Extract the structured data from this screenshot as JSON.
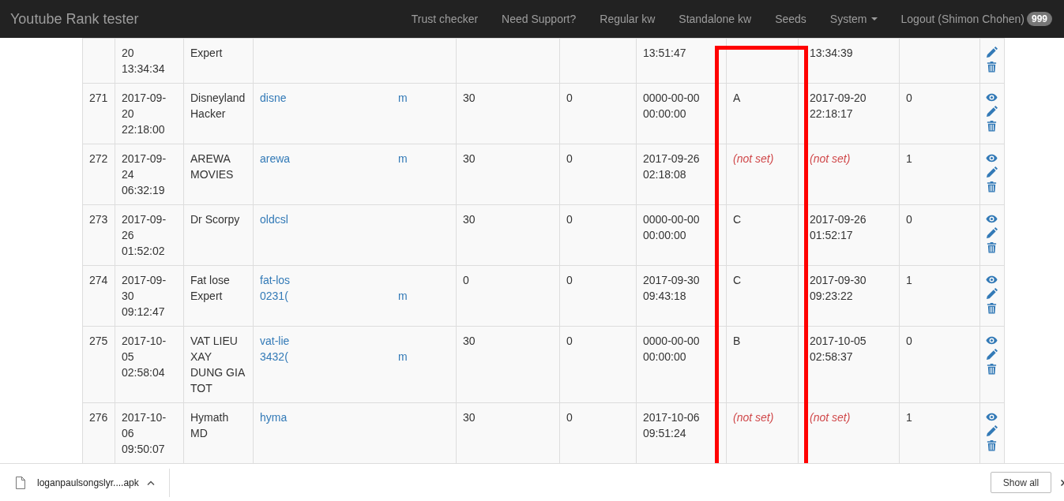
{
  "navbar": {
    "brand": "Youtube Rank tester",
    "links": [
      {
        "label": "Trust checker",
        "kind": "link"
      },
      {
        "label": "Need Support?",
        "kind": "link"
      },
      {
        "label": "Regular kw",
        "kind": "link"
      },
      {
        "label": "Standalone kw",
        "kind": "link"
      },
      {
        "label": "Seeds",
        "kind": "link"
      },
      {
        "label": "System",
        "kind": "dropdown"
      },
      {
        "label": "Logout (Shimon Chohen)",
        "kind": "link",
        "badge": "999"
      }
    ]
  },
  "table": {
    "rows": [
      {
        "created": [
          "20",
          "13:34:34"
        ],
        "name": [
          "Expert"
        ],
        "column_7": [
          "13:51:47"
        ],
        "column_9": {
          "kind": "value",
          "lines": [
            "13:34:39"
          ]
        },
        "actions": [
          {
            "kind": "edit"
          },
          {
            "kind": "delete"
          }
        ]
      },
      {
        "id": "271",
        "created": [
          "2017-09-",
          "20",
          "22:18:00"
        ],
        "name": [
          "Disneyland",
          "Hacker"
        ],
        "email": [
          {
            "text": "disne",
            "tail": "m"
          }
        ],
        "column_5": "30",
        "column_6": "0",
        "column_7": [
          "0000-00-00",
          "00:00:00"
        ],
        "column_8": {
          "kind": "value",
          "lines": [
            "A"
          ]
        },
        "column_9": {
          "kind": "value",
          "lines": [
            "2017-09-20",
            "22:18:17"
          ]
        },
        "column_10": "0",
        "actions": [
          {
            "kind": "view"
          },
          {
            "kind": "edit"
          },
          {
            "kind": "delete"
          }
        ]
      },
      {
        "id": "272",
        "created": [
          "2017-09-",
          "24",
          "06:32:19"
        ],
        "name": [
          "AREWA",
          "MOVIES"
        ],
        "email": [
          {
            "text": "arewa",
            "tail": "m"
          }
        ],
        "column_5": "30",
        "column_6": "0",
        "column_7": [
          "2017-09-26",
          "02:18:08"
        ],
        "column_8": {
          "kind": "not_set",
          "lines": [
            "(not set)"
          ]
        },
        "column_9": {
          "kind": "not_set",
          "lines": [
            "(not set)"
          ]
        },
        "column_10": "1",
        "actions": [
          {
            "kind": "view"
          },
          {
            "kind": "edit"
          },
          {
            "kind": "delete"
          }
        ]
      },
      {
        "id": "273",
        "created": [
          "2017-09-",
          "26",
          "01:52:02"
        ],
        "name": [
          "Dr Scorpy"
        ],
        "email": [
          {
            "text": "oldcsl"
          }
        ],
        "column_5": "30",
        "column_6": "0",
        "column_7": [
          "0000-00-00",
          "00:00:00"
        ],
        "column_8": {
          "kind": "value",
          "lines": [
            "C"
          ]
        },
        "column_9": {
          "kind": "value",
          "lines": [
            "2017-09-26",
            "01:52:17"
          ]
        },
        "column_10": "0",
        "actions": [
          {
            "kind": "view"
          },
          {
            "kind": "edit"
          },
          {
            "kind": "delete"
          }
        ]
      },
      {
        "id": "274",
        "created": [
          "2017-09-",
          "30",
          "09:12:47"
        ],
        "name": [
          "Fat lose",
          "Expert"
        ],
        "email": [
          {
            "text": "fat-los"
          },
          {
            "text": "0231(",
            "tail": "m"
          }
        ],
        "column_5": "0",
        "column_6": "0",
        "column_7": [
          "2017-09-30",
          "09:43:18"
        ],
        "column_8": {
          "kind": "value",
          "lines": [
            "C"
          ]
        },
        "column_9": {
          "kind": "value",
          "lines": [
            "2017-09-30",
            "09:23:22"
          ]
        },
        "column_10": "1",
        "actions": [
          {
            "kind": "view"
          },
          {
            "kind": "edit"
          },
          {
            "kind": "delete"
          }
        ]
      },
      {
        "id": "275",
        "created": [
          "2017-10-",
          "05",
          "02:58:04"
        ],
        "name": [
          "VAT LIEU",
          "XAY",
          "DUNG GIA",
          "TOT"
        ],
        "email": [
          {
            "text": "vat-lie"
          },
          {
            "text": "3432(",
            "tail": "m"
          }
        ],
        "column_5": "30",
        "column_6": "0",
        "column_7": [
          "0000-00-00",
          "00:00:00"
        ],
        "column_8": {
          "kind": "value",
          "lines": [
            "B"
          ]
        },
        "column_9": {
          "kind": "value",
          "lines": [
            "2017-10-05",
            "02:58:37"
          ]
        },
        "column_10": "0",
        "actions": [
          {
            "kind": "view"
          },
          {
            "kind": "edit"
          },
          {
            "kind": "delete"
          }
        ]
      },
      {
        "id": "276",
        "created": [
          "2017-10-",
          "06",
          "09:50:07"
        ],
        "name": [
          "Hymath",
          "MD"
        ],
        "email": [
          {
            "text": "hyma"
          }
        ],
        "column_5": "30",
        "column_6": "0",
        "column_7": [
          "2017-10-06",
          "09:51:24"
        ],
        "column_8": {
          "kind": "not_set",
          "lines": [
            "(not set)"
          ]
        },
        "column_9": {
          "kind": "not_set",
          "lines": [
            "(not set)"
          ]
        },
        "column_10": "1",
        "actions": [
          {
            "kind": "view"
          },
          {
            "kind": "edit"
          },
          {
            "kind": "delete"
          }
        ]
      }
    ]
  },
  "download_bar": {
    "file_name": "loganpaulsongslyr....apk",
    "show_all": "Show all"
  }
}
